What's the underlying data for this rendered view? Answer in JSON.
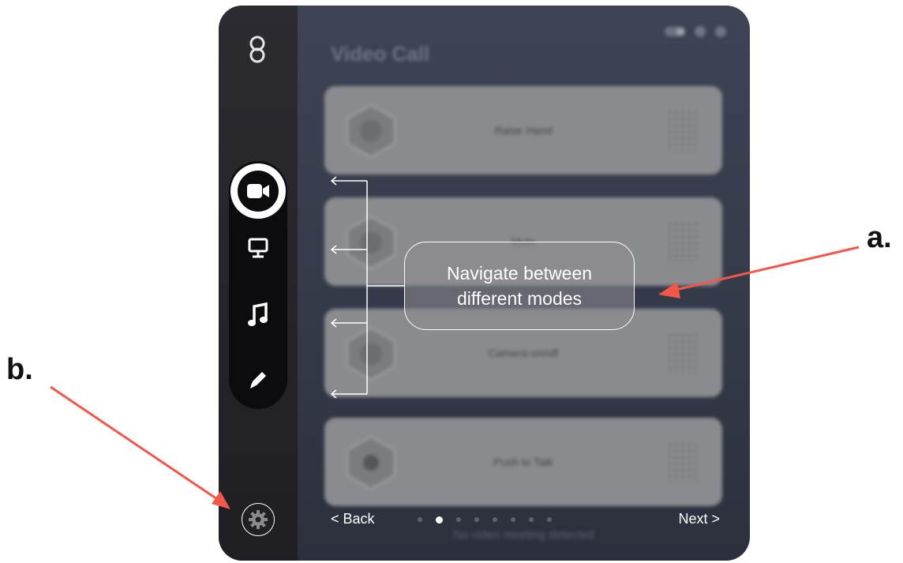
{
  "window": {
    "title": "Video Call",
    "top_icons": [
      "toggle-icon",
      "help-icon",
      "power-icon"
    ]
  },
  "sidebar": {
    "modes": [
      {
        "name": "video-call",
        "icon": "video-camera-icon",
        "active": true
      },
      {
        "name": "presentation",
        "icon": "monitor-icon",
        "active": false
      },
      {
        "name": "music",
        "icon": "music-note-icon",
        "active": false
      },
      {
        "name": "draw",
        "icon": "pencil-icon",
        "active": false
      }
    ],
    "settings_icon": "gear-icon"
  },
  "cards": [
    {
      "label": "Raise Hand"
    },
    {
      "label": "Mute"
    },
    {
      "label": "Camera on/off"
    },
    {
      "label": "Push to Talk"
    }
  ],
  "pager": {
    "back_label": "< Back",
    "next_label": "Next >",
    "page_count": 8,
    "current_page": 2
  },
  "status": {
    "text": "No video meeting detected"
  },
  "annotations": {
    "callout_line1": "Navigate between",
    "callout_line2": "different modes",
    "label_a": "a.",
    "label_b": "b.",
    "arrow_color": "#f2574a"
  },
  "colors": {
    "window_bg": "#343948",
    "sidebar_bg": "#1f1f23",
    "card_bg": "#8a8b8f",
    "accent": "#ffffff"
  }
}
